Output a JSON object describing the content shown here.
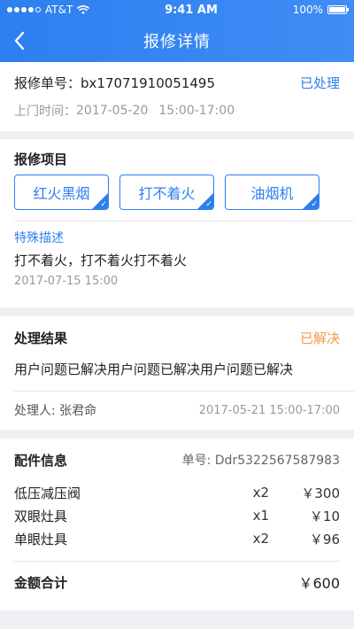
{
  "status_bar": {
    "carrier": "AT&T",
    "time": "9:41 AM",
    "battery": "100%"
  },
  "nav": {
    "title": "报修详情"
  },
  "order": {
    "number_label": "报修单号：",
    "number": "bx17071910051495",
    "status": "已处理",
    "visit_label": "上门时间：",
    "visit_date": "2017-05-20",
    "visit_time": "15:00-17:00"
  },
  "repair": {
    "title": "报修项目",
    "tags": [
      "红火黑烟",
      "打不着火",
      "油烟机"
    ],
    "special_label": "特殊描述",
    "special_text": "打不着火，打不着火打不着火",
    "special_time": "2017-07-15 15:00"
  },
  "result": {
    "title": "处理结果",
    "status": "已解决",
    "text": "用户问题已解决用户问题已解决用户问题已解决",
    "handler": "处理人: 张君命",
    "handler_time": "2017-05-21 15:00-17:00"
  },
  "parts": {
    "title": "配件信息",
    "order_no": "单号: Ddr5322567587983",
    "items": [
      {
        "name": "低压减压阀",
        "qty": "x2",
        "price": "￥300"
      },
      {
        "name": "双眼灶具",
        "qty": "x1",
        "price": "￥10"
      },
      {
        "name": "单眼灶具",
        "qty": "x2",
        "price": "￥96"
      }
    ],
    "total_label": "金额合计",
    "total": "￥600"
  }
}
